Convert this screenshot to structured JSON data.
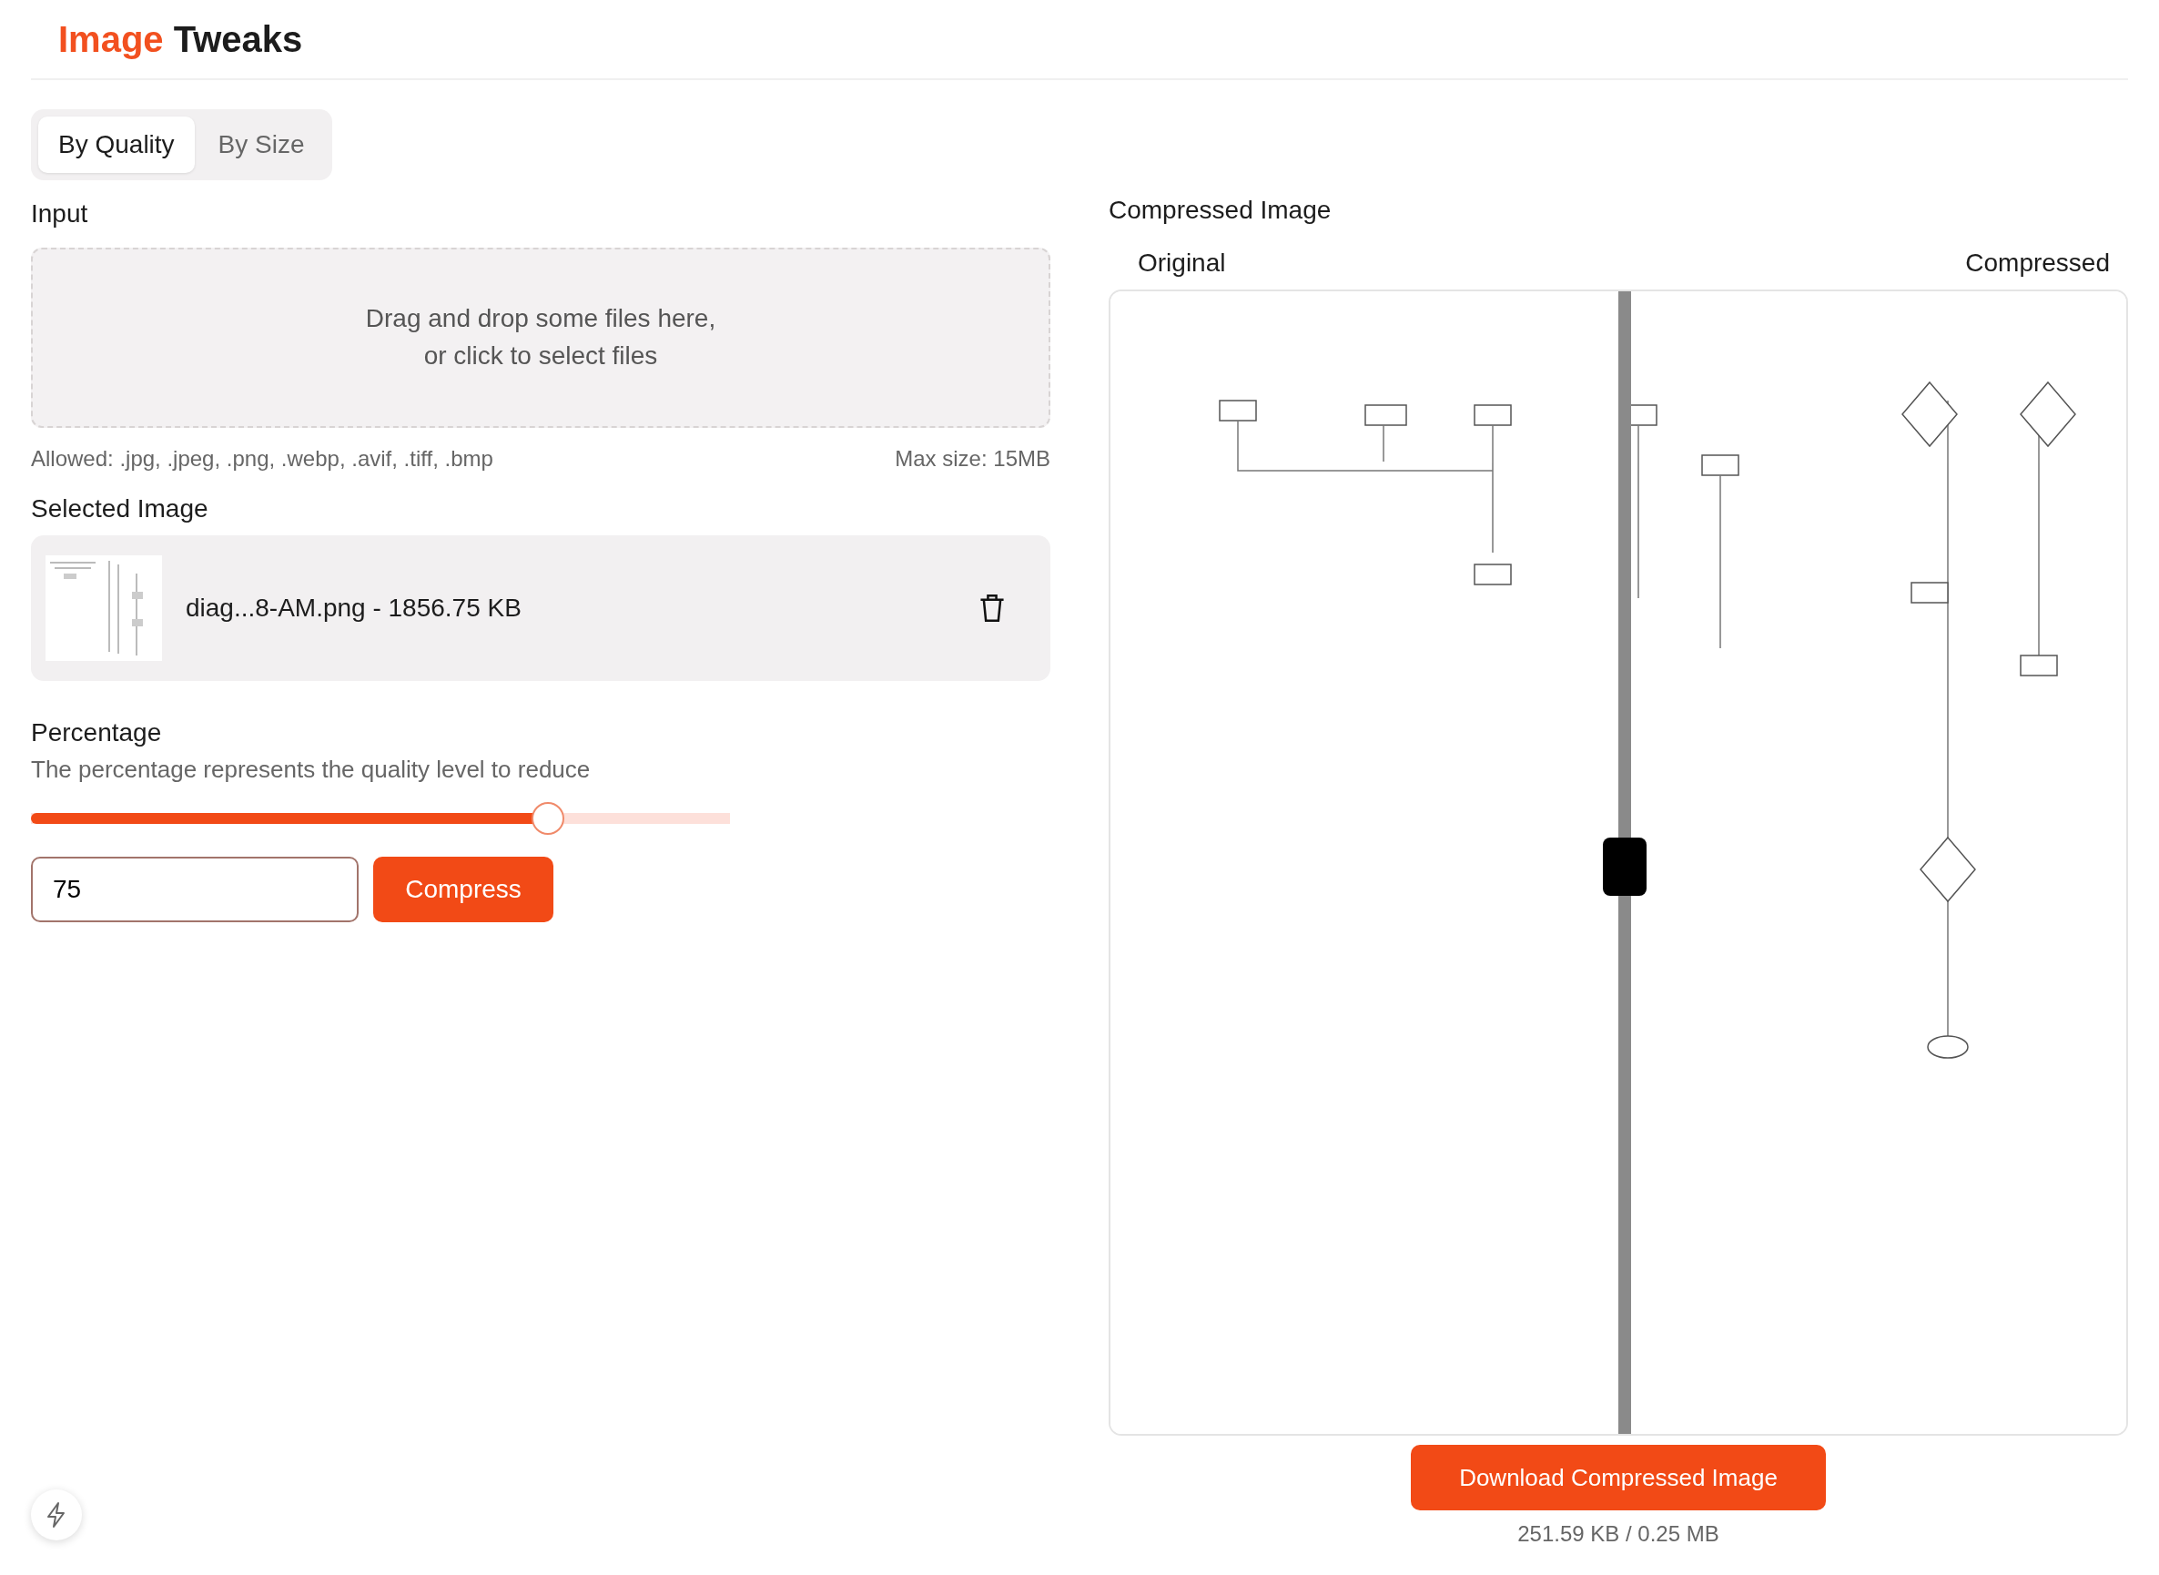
{
  "header": {
    "title_accent": "Image",
    "title_rest": "Tweaks"
  },
  "tabs": [
    {
      "label": "By Quality",
      "selected": true
    },
    {
      "label": "By Size",
      "selected": false
    }
  ],
  "input": {
    "heading": "Input",
    "dropzone_lines": [
      "Drag and drop some files here,",
      "or click to select files"
    ],
    "allowed": "Allowed: .jpg, .jpeg, .png, .webp, .avif, .tiff, .bmp",
    "max_size": "Max size: 15MB"
  },
  "selected_image": {
    "heading": "Selected Image",
    "file": "diag...8-AM.png - 1856.75 KB"
  },
  "percentage": {
    "heading": "Percentage",
    "description": "The percentage represents the quality level to reduce",
    "level": 0.74,
    "value": "75",
    "button": "Compress"
  },
  "result": {
    "heading": "Compressed Image",
    "left_label": "Original",
    "right_label": "Compressed",
    "button": "Download Compressed Image",
    "size": "251.59 KB / 0.25 MB"
  }
}
